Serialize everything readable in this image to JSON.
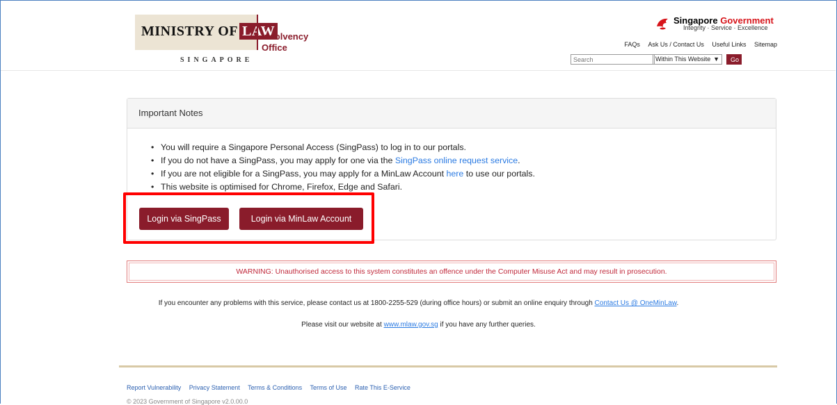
{
  "header": {
    "logo": {
      "ministry": "MINISTRY OF",
      "law": "LAW",
      "unit_line1": "Insolvency",
      "unit_line2": "Office",
      "country": "SINGAPORE"
    },
    "gov_banner": {
      "title_part1": "Singapore",
      "title_part2": "Government",
      "tagline": "Integrity · Service · Excellence",
      "title_color": "#d7141a"
    },
    "top_links": [
      "FAQs",
      "Ask Us / Contact Us",
      "Useful Links",
      "Sitemap"
    ],
    "search": {
      "placeholder": "Search",
      "scope": "Within This Website",
      "go_label": "Go"
    }
  },
  "panel": {
    "title": "Important Notes",
    "notes": {
      "n1": "You will require a Singapore Personal Access (SingPass) to log in to our portals.",
      "n2_pre": "If you do not have a SingPass, you may apply for one via the ",
      "n2_link": "SingPass online request service",
      "n2_post": ".",
      "n3_pre": "If you are not eligible for a SingPass, you may apply for a MinLaw Account ",
      "n3_link": "here",
      "n3_post": " to use our portals.",
      "n4": "This website is optimised for Chrome, Firefox, Edge and Safari."
    },
    "buttons": {
      "singpass": "Login via SingPass",
      "minlaw": "Login via MinLaw Account"
    },
    "accent_color": "#8a1c2b"
  },
  "warning": "WARNING: Unauthorised access to this system constitutes an offence under the Computer Misuse Act and may result in prosecution.",
  "contact": {
    "line1_pre": "If you encounter any problems with this service, please contact us at 1800-2255-529 (during office hours) or submit an online enquiry through ",
    "line1_link": "Contact Us @ OneMinLaw",
    "line1_post": ".",
    "line2_pre": "Please visit our website at ",
    "line2_link": "www.mlaw.gov.sg",
    "line2_post": " if you have any further queries."
  },
  "footer": {
    "links": [
      "Report Vulnerability",
      "Privacy Statement",
      "Terms & Conditions",
      "Terms of Use",
      "Rate This E-Service"
    ],
    "copyright": "© 2023 Government of Singapore v2.0.00.0"
  }
}
